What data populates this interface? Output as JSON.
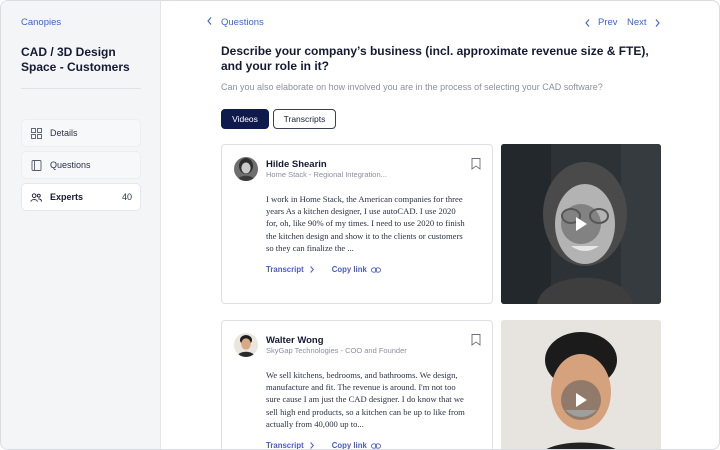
{
  "sidebar": {
    "breadcrumb": "Canopies",
    "title": "CAD / 3D Design Space - Customers",
    "items": [
      {
        "label": "Details",
        "icon": "grid-icon"
      },
      {
        "label": "Questions",
        "icon": "book-icon"
      },
      {
        "label": "Experts",
        "icon": "people-icon",
        "count": "40"
      }
    ]
  },
  "topnav": {
    "back_label": "Questions",
    "prev_label": "Prev",
    "next_label": "Next"
  },
  "question": {
    "title": "Describe your company’s business (incl. approximate revenue size & FTE), and your role in it?",
    "subtitle": "Can you also elaborate on how involved you are in the process of selecting your CAD software?"
  },
  "tabs": {
    "videos": "Videos",
    "transcripts": "Transcripts"
  },
  "answers": [
    {
      "name": "Hilde Shearin",
      "role": "Home Stack - Regional Integration...",
      "quote": "I work in Home Stack, the American companies for three years As a kitchen designer, I use autoCAD. I use 2020 for, oh, like 90% of my times. I need to use 2020 to finish the kitchen design and show it to the clients or customers so they can finalize the ...",
      "transcript_label": "Transcript",
      "copy_label": "Copy link"
    },
    {
      "name": "Walter Wong",
      "role": "SkyGap Technologies - COO and Founder",
      "quote": "We sell kitchens, bedrooms, and bathrooms. We design, manufacture and fit. The revenue is around. I'm not too sure cause I am just the CAD designer. I do know that we sell high end products, so a kitchen can be up to like from actually from 40,000 up to...",
      "transcript_label": "Transcript",
      "copy_label": "Copy link"
    }
  ],
  "colors": {
    "accent": "#3a63d8",
    "tab_active": "#0f1b4c",
    "link": "#4a5bd0"
  }
}
